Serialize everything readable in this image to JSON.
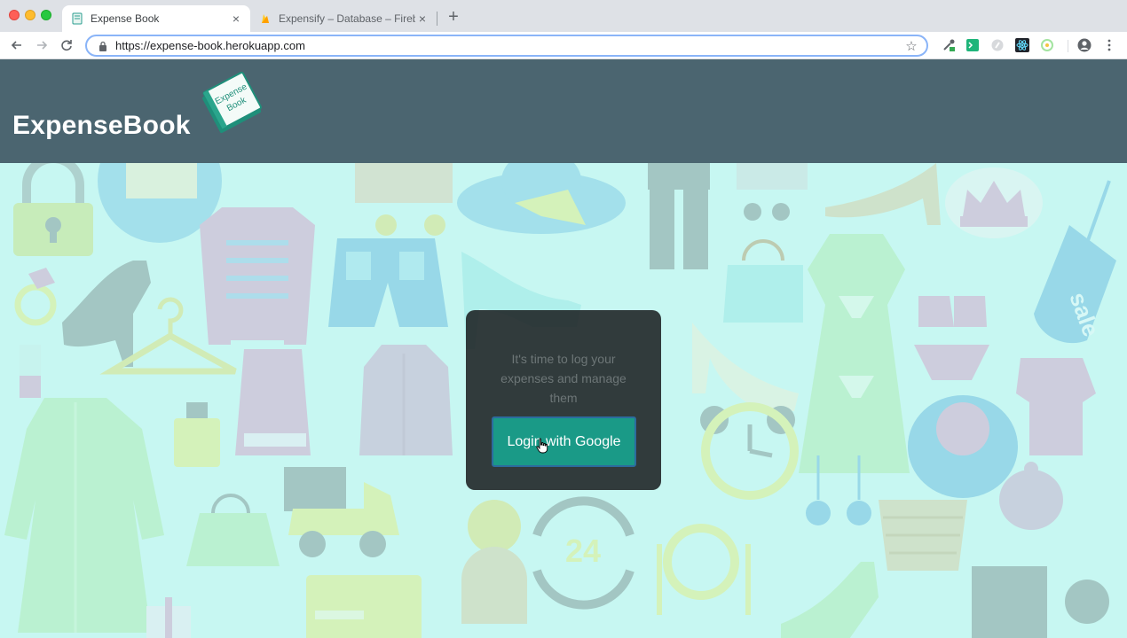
{
  "browser": {
    "tabs": [
      {
        "title": "Expense Book",
        "active": true
      },
      {
        "title": "Expensify – Database – Fireba",
        "active": false
      }
    ],
    "new_tab_symbol": "+",
    "close_symbol": "×",
    "url": "https://expense-book.herokuapp.com"
  },
  "header": {
    "brand": "ExpenseBook",
    "logo_text_line1": "Expense",
    "logo_text_line2": "Book"
  },
  "login": {
    "tagline": "It's time to log your expenses and manage them",
    "button_label": "Login with Google"
  },
  "background": {
    "badge_24": "24",
    "sale_tag": "sale"
  },
  "colors": {
    "header_bg": "#4b6570",
    "button_bg": "#1a9a87",
    "page_bg": "#c7f5f0"
  }
}
